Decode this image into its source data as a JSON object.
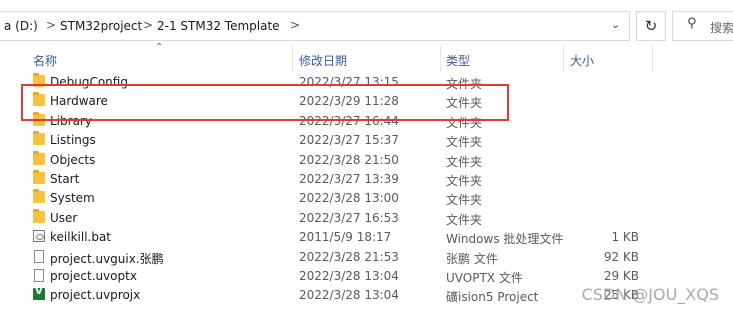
{
  "breadcrumb": {
    "items": [
      {
        "label": "a (D:)"
      },
      {
        "label": "STM32project"
      },
      {
        "label": "2-1 STM32 Template"
      }
    ],
    "separator": ">",
    "dropdown_icon": "chevron-down-icon"
  },
  "toolbar": {
    "refresh_icon": "refresh-icon"
  },
  "search": {
    "placeholder": "搜索\"",
    "icon": "search-icon"
  },
  "columns": {
    "name": "名称",
    "modified": "修改日期",
    "type": "类型",
    "size": "大小"
  },
  "files": [
    {
      "name": "DebugConfig",
      "modified": "2022/3/27 13:15",
      "type": "文件夹",
      "size": "",
      "icon": "folder-icon"
    },
    {
      "name": "Hardware",
      "modified": "2022/3/29 11:28",
      "type": "文件夹",
      "size": "",
      "icon": "folder-icon"
    },
    {
      "name": "Library",
      "modified": "2022/3/27 16:44",
      "type": "文件夹",
      "size": "",
      "icon": "folder-icon"
    },
    {
      "name": "Listings",
      "modified": "2022/3/27 15:37",
      "type": "文件夹",
      "size": "",
      "icon": "folder-icon"
    },
    {
      "name": "Objects",
      "modified": "2022/3/28 21:50",
      "type": "文件夹",
      "size": "",
      "icon": "folder-icon"
    },
    {
      "name": "Start",
      "modified": "2022/3/27 13:39",
      "type": "文件夹",
      "size": "",
      "icon": "folder-icon"
    },
    {
      "name": "System",
      "modified": "2022/3/28 13:00",
      "type": "文件夹",
      "size": "",
      "icon": "folder-icon"
    },
    {
      "name": "User",
      "modified": "2022/3/27 16:53",
      "type": "文件夹",
      "size": "",
      "icon": "folder-icon"
    },
    {
      "name": "keilkill.bat",
      "modified": "2011/5/9 18:17",
      "type": "Windows 批处理文件",
      "size": "1 KB",
      "icon": "batch-file-icon"
    },
    {
      "name": "project.uvguix.张鹏",
      "modified": "2022/3/28 21:53",
      "type": "张鹏 文件",
      "size": "92 KB",
      "icon": "document-icon"
    },
    {
      "name": "project.uvoptx",
      "modified": "2022/3/28 13:04",
      "type": "UVOPTX 文件",
      "size": "29 KB",
      "icon": "document-icon"
    },
    {
      "name": "project.uvprojx",
      "modified": "2022/3/28 13:04",
      "type": "礦ision5 Project",
      "size": "25 KB",
      "icon": "keil-project-icon"
    }
  ],
  "watermark": "CSDN @JOU_XQS",
  "colors": {
    "highlight": "#e53935",
    "folder": "#f5c242",
    "header_text": "#3a5a9a"
  }
}
